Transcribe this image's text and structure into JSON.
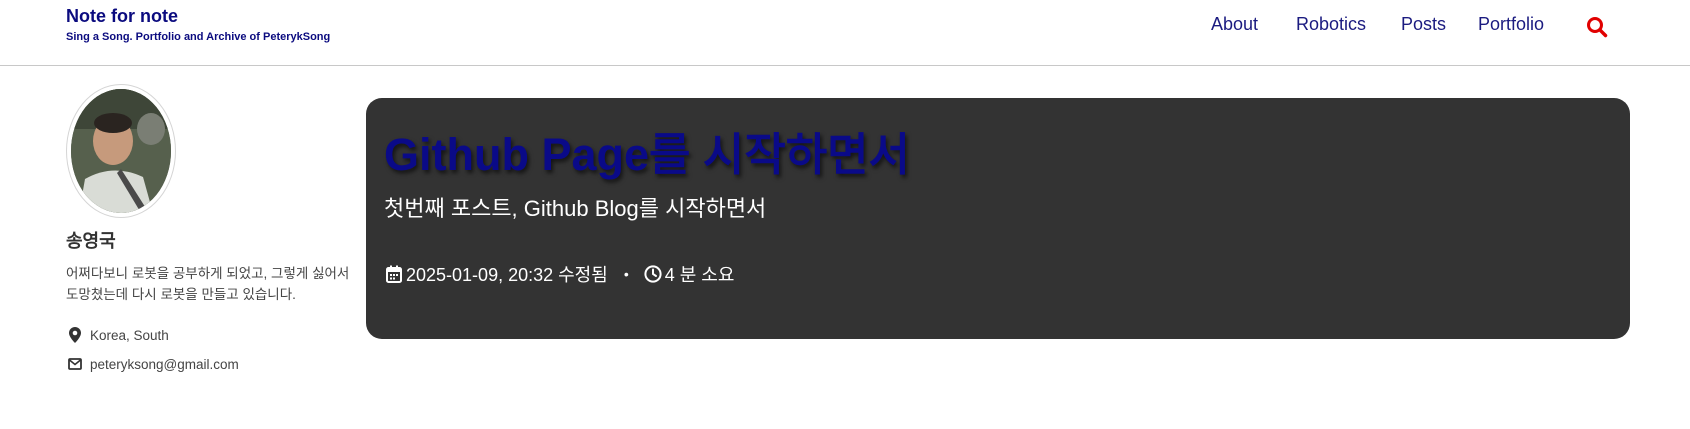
{
  "site": {
    "title": "Note for note",
    "subtitle": "Sing a Song. Portfolio and Archive of PeterykSong"
  },
  "nav": {
    "items": [
      {
        "label": "About"
      },
      {
        "label": "Robotics"
      },
      {
        "label": "Posts"
      },
      {
        "label": "Portfolio"
      }
    ],
    "search_icon": "search-icon",
    "accent_color": "#e10000"
  },
  "author": {
    "name": "송영국",
    "bio": "어쩌다보니 로봇을 공부하게 되었고, 그렇게 싫어서 도망쳤는데 다시 로봇을 만들고 있습니다.",
    "location": "Korea, South",
    "location_icon": "map-marker-icon",
    "email": "peteryksong@gmail.com",
    "email_icon": "envelope-icon"
  },
  "post": {
    "title": "Github Page를 시작하면서",
    "excerpt": "첫번째 포스트, Github Blog를 시작하면서",
    "date": "2025-01-09, 20:32 수정됨",
    "date_icon": "calendar-icon",
    "separator": "•",
    "read_time": "4 분 소요",
    "read_time_icon": "clock-icon",
    "card_color": "#333333",
    "title_color": "#0a0a88"
  }
}
